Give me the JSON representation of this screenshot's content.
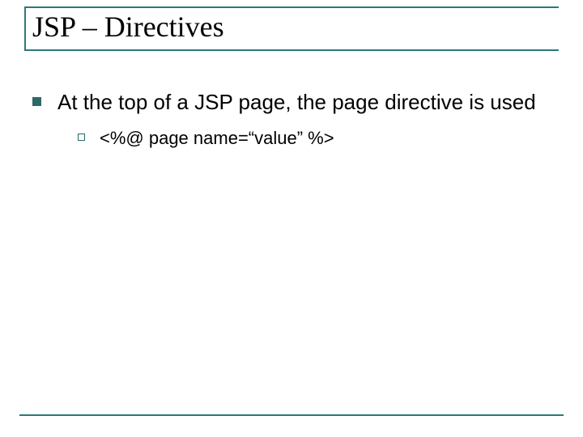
{
  "title": "JSP – Directives",
  "body": {
    "level1": "At the top of a JSP page, the page directive is used",
    "level2": "<%@ page name=“value” %>"
  }
}
